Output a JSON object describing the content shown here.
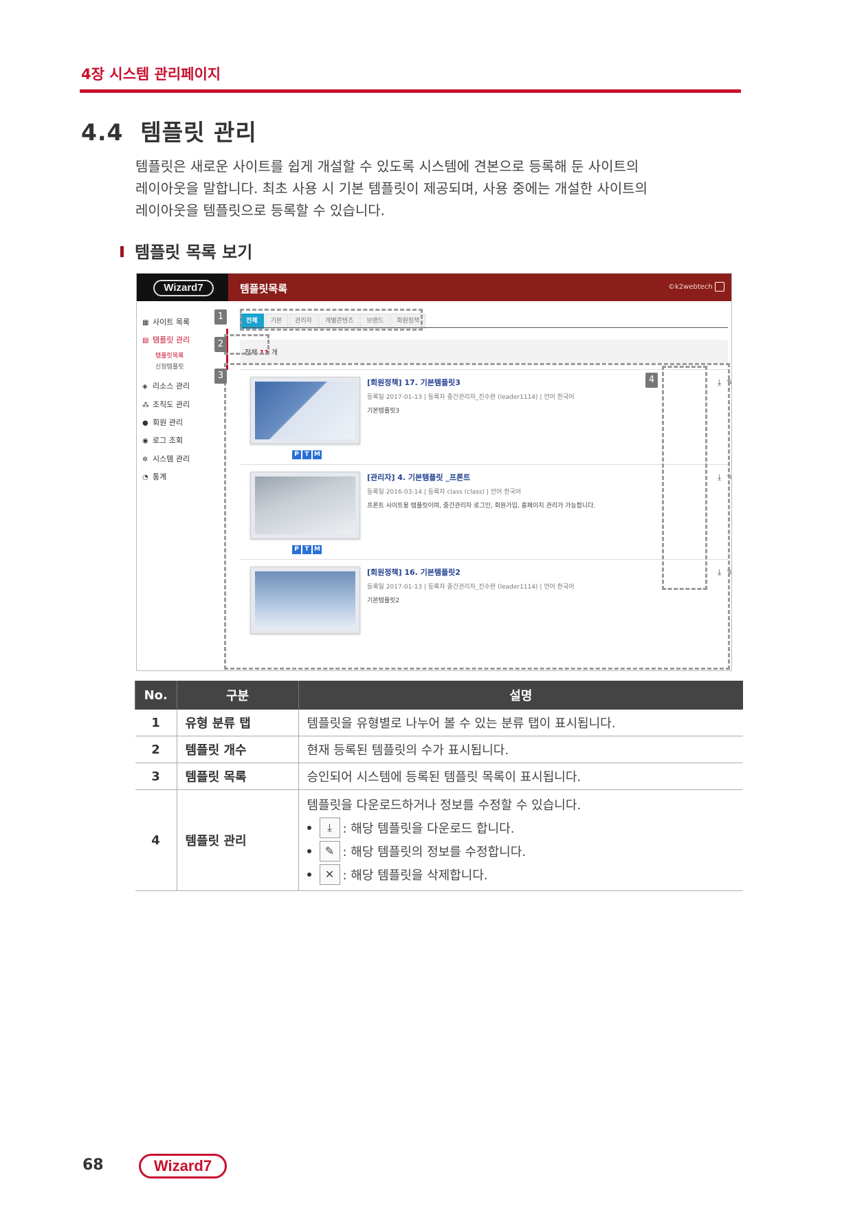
{
  "header": {
    "chapter": "4장 시스템 관리페이지"
  },
  "section": {
    "title": "4.4  템플릿 관리",
    "intro": [
      "템플릿은 새로운 사이트를 쉽게 개설할 수 있도록 시스템에 견본으로 등록해 둔 사이트의",
      "레이아웃을 말합니다. 최초 사용 시 기본 템플릿이 제공되며, 사용 중에는 개설한 사이트의",
      "레이아웃을 템플릿으로 등록할 수 있습니다."
    ],
    "subtitle": "템플릿 목록 보기"
  },
  "screenshot": {
    "logo": "Wizard7",
    "title": "템플릿목록",
    "user": "©k2webtech",
    "sidebar": [
      {
        "label": "사이트 목록",
        "icon": "grid-icon"
      },
      {
        "label": "템플릿 관리",
        "icon": "template-icon",
        "active": true
      },
      {
        "label": "리소스 관리",
        "icon": "resource-icon"
      },
      {
        "label": "조직도 관리",
        "icon": "org-icon"
      },
      {
        "label": "회원 관리",
        "icon": "user-icon"
      },
      {
        "label": "로그 조회",
        "icon": "log-icon"
      },
      {
        "label": "시스템 관리",
        "icon": "gear-icon"
      },
      {
        "label": "통계",
        "icon": "chart-icon"
      }
    ],
    "sidebar_sub": [
      {
        "label": "템플릿목록",
        "active": true
      },
      {
        "label": "신청템플릿"
      }
    ],
    "tabs": [
      "전체",
      "기본",
      "관리자",
      "개별콘텐츠",
      "브랜드",
      "회원정책"
    ],
    "count": {
      "prefix": "전체",
      "value": "11",
      "suffix": "개"
    },
    "cards": [
      {
        "title": "[회원정책] 17. 기본템플릿3",
        "meta": "등록일  2017-01-13   |  등록자  중간관리자_진수완 (leader1114)  |  언어  한국어",
        "desc": "기본템플릿3"
      },
      {
        "title": "[관리자] 4. 기본템플릿 _프론트",
        "meta": "등록일  2016-03-14   |  등록자  class (class)   |  언어  한국어",
        "desc": "프론트 사이트용 템플릿이며, 중간관리자 로그인, 회원가입, 홈페이지 관리가 가능합니다."
      },
      {
        "title": "[회원정책] 16. 기본템플릿2",
        "meta": "등록일  2017-01-13   |  등록자  중간관리자_진수완 (leader1114)  |  언어  한국어",
        "desc": "기본템플릿2"
      }
    ],
    "ptm": [
      "P",
      "T",
      "M"
    ],
    "badges": [
      "1",
      "2",
      "3",
      "4"
    ],
    "actions": [
      "download-icon",
      "edit-icon",
      "delete-icon"
    ]
  },
  "table": {
    "headers": [
      "No.",
      "구분",
      "설명"
    ],
    "rows": [
      {
        "no": "1",
        "cat": "유형 분류 탭",
        "desc": "템플릿을 유형별로 나누어 볼 수 있는 분류 탭이 표시됩니다."
      },
      {
        "no": "2",
        "cat": "템플릿 개수",
        "desc": "현재 등록된 템플릿의 수가 표시됩니다."
      },
      {
        "no": "3",
        "cat": "템플릿 목록",
        "desc": "승인되어 시스템에 등록된 템플릿 목록이 표시됩니다."
      },
      {
        "no": "4",
        "cat": "템플릿 관리",
        "desc": "템플릿을 다운로드하거나 정보를 수정할 수 있습니다.",
        "bullets": [
          ": 해당 템플릿을 다운로드 합니다.",
          ": 해당 템플릿의 정보를 수정합니다.",
          ": 해당 템플릿을 삭제합니다."
        ]
      }
    ]
  },
  "footer": {
    "page": "68",
    "logo": "Wizard7"
  }
}
